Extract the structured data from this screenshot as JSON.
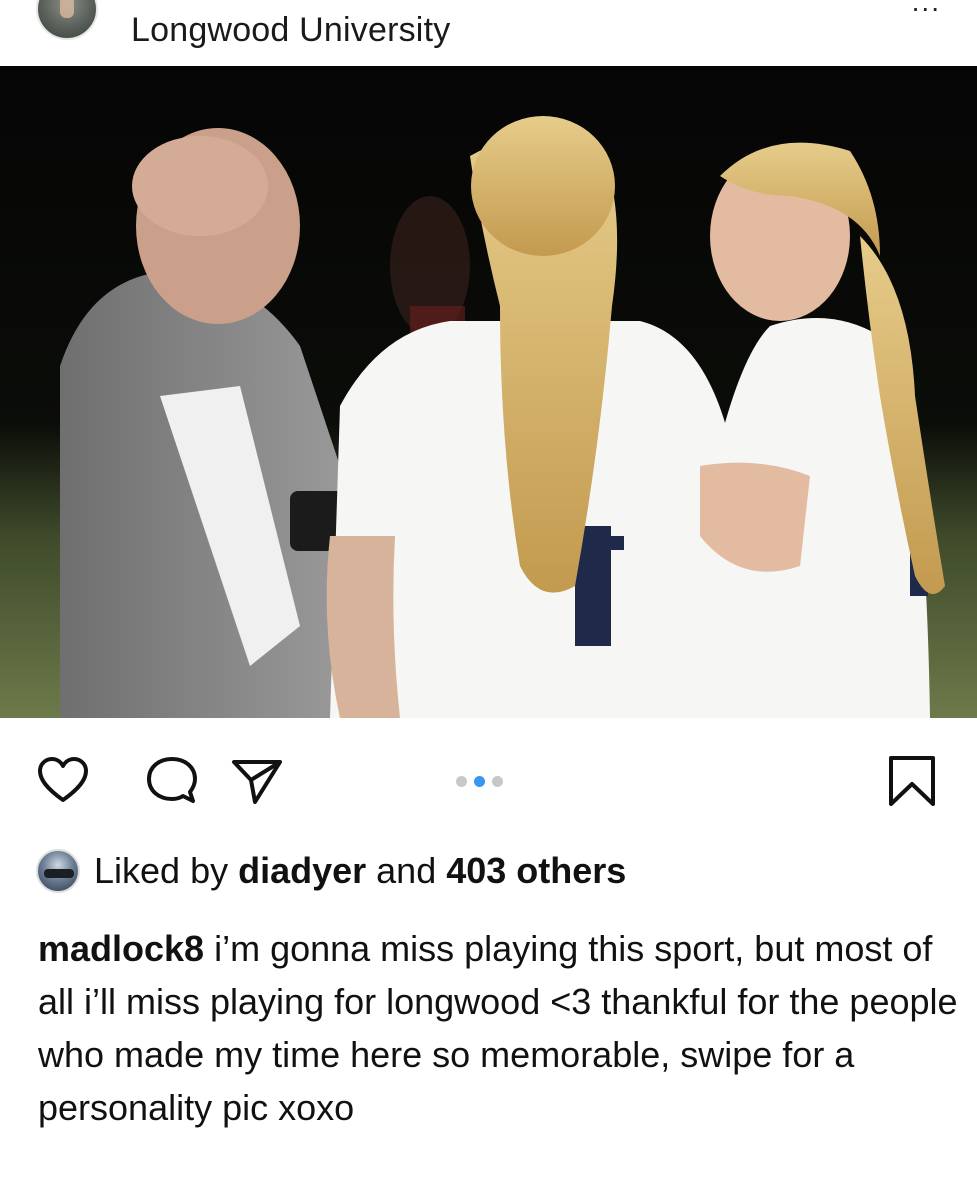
{
  "post": {
    "location": "Longwood University",
    "more_label": "...",
    "liked_by": {
      "prefix": "Liked by ",
      "user": "diadyer",
      "middle": " and ",
      "count_text": "403 others"
    },
    "caption": {
      "username": "madlock8",
      "text": " i’m gonna miss playing this sport, but most of all i’ll miss playing for longwood <3 thankful for the people who made my time here so memorable, swipe for a personality pic xoxo"
    },
    "carousel": {
      "total": 3,
      "active_index": 1
    }
  },
  "colors": {
    "accent": "#3897f0",
    "inactive_dot": "#c8c8c8",
    "text": "#111111"
  },
  "icons": [
    "heart-icon",
    "comment-icon",
    "share-icon",
    "bookmark-icon"
  ]
}
